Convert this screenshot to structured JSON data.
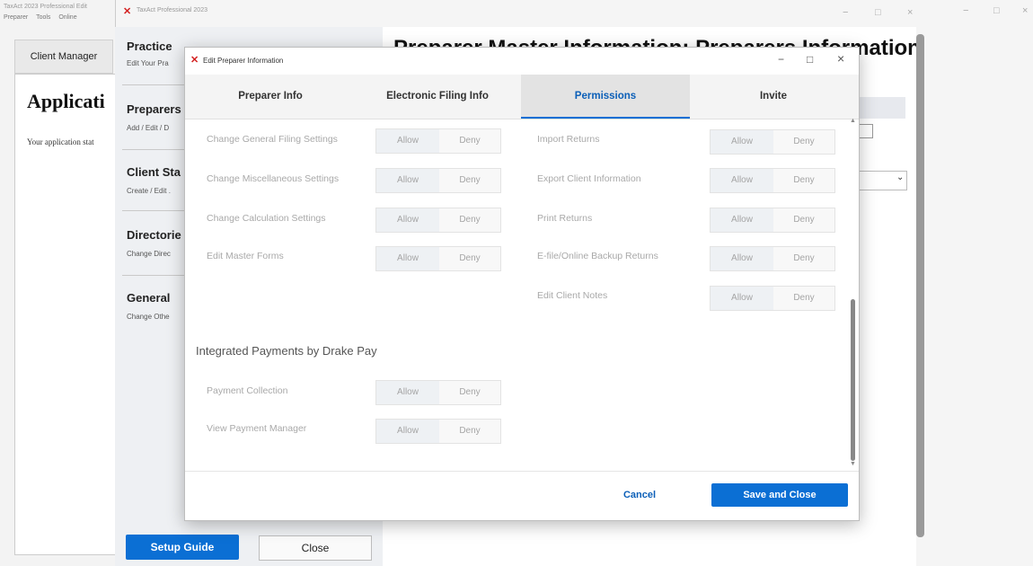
{
  "background_app": {
    "title": "TaxAct 2023 Professional Edit",
    "menu": [
      "Preparer",
      "Tools",
      "Online"
    ],
    "tab": "Client Manager",
    "page_title": "Applicati",
    "page_status": "Your application stat"
  },
  "setup_window": {
    "title": "TaxAct Professional 2023",
    "sections": [
      {
        "heading": "Practice",
        "sub": "Edit Your Pra"
      },
      {
        "heading": "Preparers",
        "sub": "Add / Edit / D"
      },
      {
        "heading": "Client Sta",
        "sub": "Create / Edit ."
      },
      {
        "heading": "Directorie",
        "sub": "Change Direc"
      },
      {
        "heading": "General",
        "sub": "Change Othe"
      }
    ],
    "main_heading": "Preparer Master Information: Preparers Information",
    "setup_guide_label": "Setup Guide",
    "close_label": "Close",
    "colors": {
      "accent": "#0b6fd4"
    }
  },
  "dialog": {
    "title": "Edit Preparer Information",
    "window_buttons": {
      "minimize": "−",
      "maximize": "□",
      "close": "×"
    },
    "tabs": [
      {
        "label": "Preparer Info",
        "active": false
      },
      {
        "label": "Electronic Filing Info",
        "active": false
      },
      {
        "label": "Permissions",
        "active": true
      },
      {
        "label": "Invite",
        "active": false
      }
    ],
    "left_permissions": [
      {
        "label": "Change General Filing Settings",
        "allow": "Allow",
        "deny": "Deny"
      },
      {
        "label": "Change Miscellaneous Settings",
        "allow": "Allow",
        "deny": "Deny"
      },
      {
        "label": "Change Calculation Settings",
        "allow": "Allow",
        "deny": "Deny"
      },
      {
        "label": "Edit Master Forms",
        "allow": "Allow",
        "deny": "Deny"
      }
    ],
    "right_permissions": [
      {
        "label": "Import Returns",
        "allow": "Allow",
        "deny": "Deny"
      },
      {
        "label": "Export Client Information",
        "allow": "Allow",
        "deny": "Deny"
      },
      {
        "label": "Print Returns",
        "allow": "Allow",
        "deny": "Deny"
      },
      {
        "label": "E-file/Online Backup Returns",
        "allow": "Allow",
        "deny": "Deny"
      },
      {
        "label": "Edit Client Notes",
        "allow": "Allow",
        "deny": "Deny"
      }
    ],
    "payments_group_heading": "Integrated Payments by Drake Pay",
    "payment_permissions": [
      {
        "label": "Payment Collection",
        "allow": "Allow",
        "deny": "Deny"
      },
      {
        "label": "View Payment Manager",
        "allow": "Allow",
        "deny": "Deny"
      }
    ],
    "cancel_label": "Cancel",
    "save_label": "Save and Close"
  }
}
